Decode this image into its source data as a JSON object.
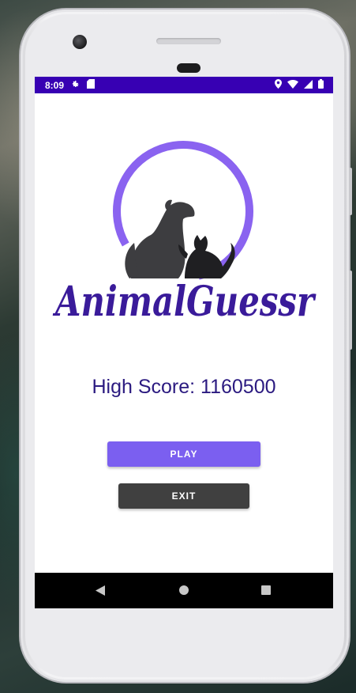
{
  "status_bar": {
    "time": "8:09",
    "background": "#3700b3",
    "icons_left": [
      "gear-icon",
      "sim-card-icon"
    ],
    "icons_right": [
      "location-icon",
      "wifi-icon",
      "signal-icon",
      "battery-icon"
    ]
  },
  "logo": {
    "text": "AnimalGuessr",
    "ring_color": "#8a63f0",
    "text_color": "#3a1b9a"
  },
  "high_score": {
    "label": "High Score: 1160500",
    "color": "#2b1a80"
  },
  "buttons": {
    "play_label": "PLAY",
    "play_color": "#7b5ff0",
    "exit_label": "EXIT",
    "exit_color": "#404040"
  },
  "nav_bar": {
    "icons": [
      "back-icon",
      "home-icon",
      "recent-apps-icon"
    ]
  }
}
